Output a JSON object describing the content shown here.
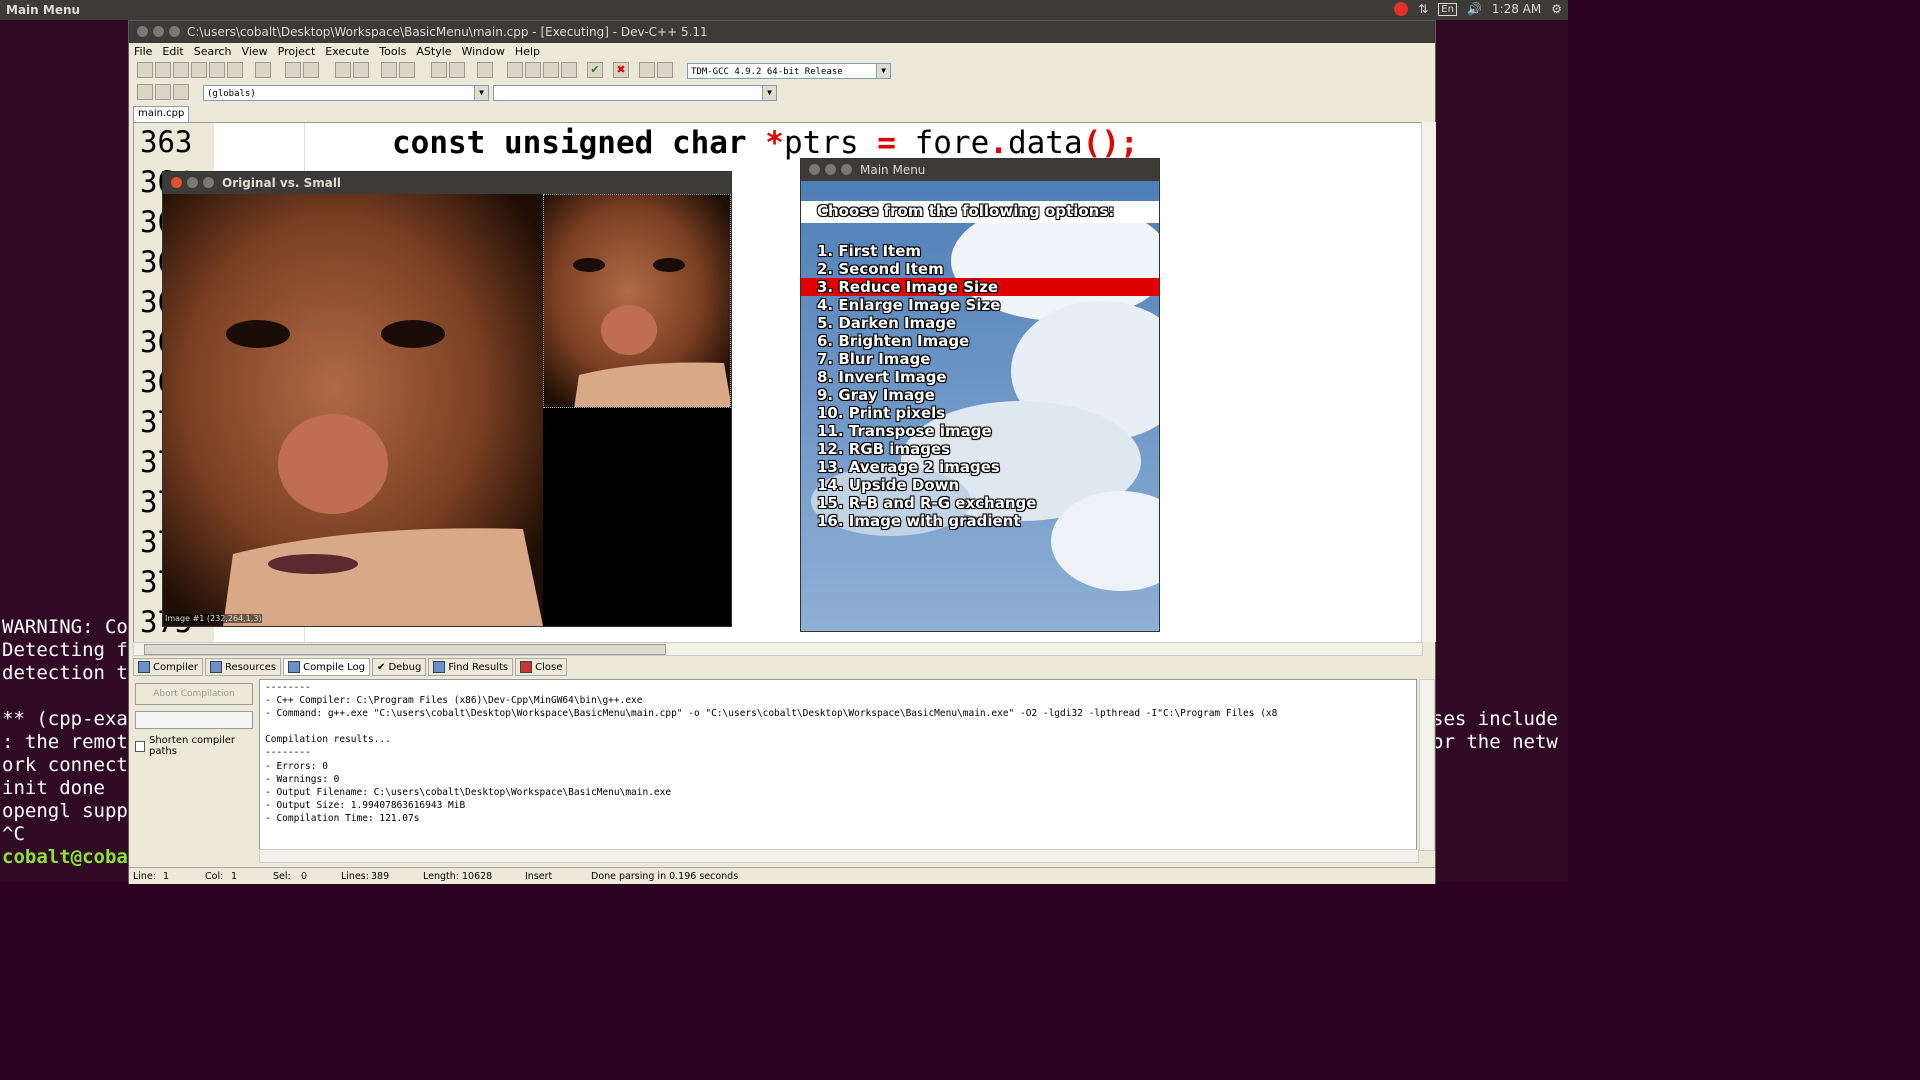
{
  "topbar": {
    "title": "Main Menu",
    "lang": "En",
    "time": "1:28 AM"
  },
  "terminal": {
    "left_lines": [
      "WARNING: Co",
      "Detecting f",
      "detection t",
      "",
      "** (cpp-exa",
      ": the remot",
      "ork connect",
      "init done",
      "opengl supp",
      "^C"
    ],
    "prompt": "cobalt@coba",
    "right_lines": [
      "ses include",
      "or the netw"
    ]
  },
  "devcpp": {
    "title": "C:\\users\\cobalt\\Desktop\\Workspace\\BasicMenu\\main.cpp - [Executing] - Dev-C++ 5.11",
    "menu": [
      "File",
      "Edit",
      "Search",
      "View",
      "Project",
      "Execute",
      "Tools",
      "AStyle",
      "Window",
      "Help"
    ],
    "compiler_combo": "TDM-GCC 4.9.2 64-bit Release",
    "scope_combo": "(globals)",
    "file_tab": "main.cpp",
    "line_numbers": [
      "363",
      "364",
      "365",
      "366",
      "367",
      "368",
      "369",
      "370",
      "371",
      "372",
      "373",
      "374",
      "375"
    ],
    "code_line1_kw": "const unsigned char ",
    "code_line1_star": "*",
    "code_line1_rest": "ptrs ",
    "code_line1_eq": "=",
    "code_line1_tail": " fore",
    "code_line1_dot": ".",
    "code_line1_data": "data",
    "code_line1_paren": "();",
    "bottom_tabs": [
      "Compiler",
      "Resources",
      "Compile Log",
      "Debug",
      "Find Results",
      "Close"
    ],
    "abort_label": "Abort Compilation",
    "shorten_label": "Shorten compiler paths",
    "log": [
      "--------",
      "- C++ Compiler: C:\\Program Files (x86)\\Dev-Cpp\\MinGW64\\bin\\g++.exe",
      "- Command: g++.exe \"C:\\users\\cobalt\\Desktop\\Workspace\\BasicMenu\\main.cpp\" -o \"C:\\users\\cobalt\\Desktop\\Workspace\\BasicMenu\\main.exe\" -O2 -lgdi32 -lpthread -I\"C:\\Program Files (x8",
      "",
      "Compilation results...",
      "--------",
      "- Errors: 0",
      "- Warnings: 0",
      "- Output Filename: C:\\users\\cobalt\\Desktop\\Workspace\\BasicMenu\\main.exe",
      "- Output Size: 1.99407863616943 MiB",
      "- Compilation Time: 121.07s"
    ],
    "status": {
      "line": "Line:",
      "line_v": "1",
      "col": "Col:",
      "col_v": "1",
      "sel": "Sel:",
      "sel_v": "0",
      "lines": "Lines:",
      "lines_v": "389",
      "length": "Length: 10628",
      "mode": "Insert",
      "parse": "Done parsing in 0.196 seconds"
    }
  },
  "imgwin": {
    "title": "Original vs. Small",
    "label": "Image #1 (232,264,1,3)"
  },
  "menuwin": {
    "title": "Main Menu",
    "prompt": "Choose from the following options:",
    "items": [
      "1. First Item",
      "2. Second Item",
      "3. Reduce Image Size",
      "4. Enlarge Image Size",
      "5. Darken Image",
      "6. Brighten Image",
      "7. Blur Image",
      "8. Invert Image",
      "9. Gray Image",
      "10. Print pixels",
      "11. Transpose image",
      "12. RGB images",
      "13. Average 2 images",
      "14. Upside Down",
      "15. R-B and R-G exchange",
      "16. Image with gradient"
    ],
    "selected_index": 2,
    "highlight_color": "#e00000"
  }
}
